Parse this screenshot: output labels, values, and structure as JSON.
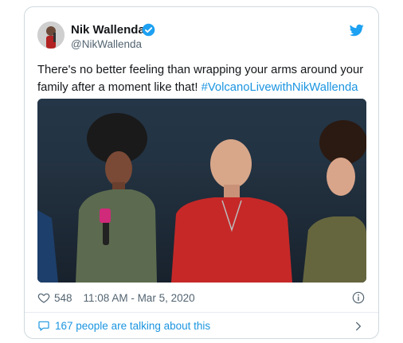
{
  "tweet": {
    "author_name": "Nik Wallenda",
    "author_handle": "@NikWallenda",
    "text_line1": "There's no better feeling than wrapping your arms around your",
    "text_line2_plain": "family after a moment like that! ",
    "hashtag": "#VolcanoLivewithNikWallenda",
    "likes": "548",
    "timestamp": "11:08 AM - Mar 5, 2020",
    "talking": "167 people are talking about this"
  },
  "colors": {
    "accent": "#1da1f2",
    "link": "#1b95e0",
    "secondary_text": "#536471"
  },
  "icons": [
    "verified-badge-icon",
    "twitter-bird-icon",
    "heart-icon",
    "info-icon",
    "speech-bubble-icon",
    "chevron-right-icon"
  ]
}
